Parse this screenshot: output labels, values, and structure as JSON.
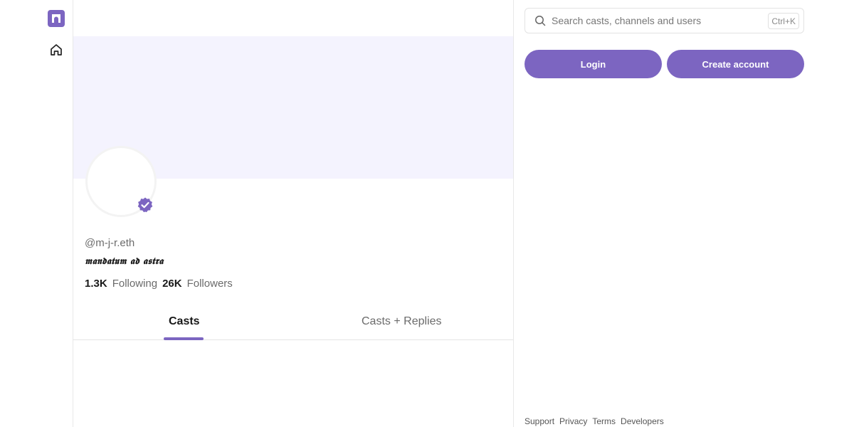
{
  "brand": {
    "accent": "#7c65c1",
    "banner_bg": "#f4f3fe"
  },
  "nav": {
    "logo_icon": "farcaster-logo-icon",
    "home_icon": "home-icon"
  },
  "profile": {
    "handle": "@m-j-r.eth",
    "bio": "𝖒𝖆𝖓𝖉𝖆𝖙𝖚𝖒 𝖆𝖉 𝖆𝖘𝖙𝖗𝖆",
    "verified": true,
    "following_count": "1.3K",
    "following_label": "Following",
    "followers_count": "26K",
    "followers_label": "Followers"
  },
  "tabs": [
    {
      "label": "Casts",
      "active": true
    },
    {
      "label": "Casts + Replies",
      "active": false
    }
  ],
  "search": {
    "placeholder": "Search casts, channels and users",
    "shortcut": "Ctrl+K"
  },
  "auth": {
    "login_label": "Login",
    "create_label": "Create account"
  },
  "footer": {
    "links": [
      "Support",
      "Privacy",
      "Terms",
      "Developers"
    ]
  }
}
